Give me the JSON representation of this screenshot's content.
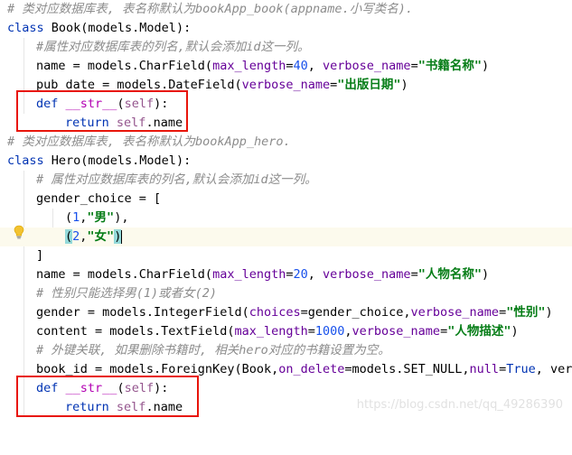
{
  "colors": {
    "comment": "#8c8c8c",
    "keyword": "#0033b3",
    "string": "#067d17",
    "number": "#1750eb",
    "param": "#660099",
    "self": "#94558d",
    "highlight_box": "#e8150b",
    "current_line": "#fcfaed"
  },
  "lines": {
    "l1": {
      "comment": "# 类对应数据库表, 表名称默认为bookApp_book(appname.小写类名)."
    },
    "l2": {
      "kw": "class",
      "rest": " Book(models.Model):"
    },
    "l3": {
      "comment": "#属性对应数据库表的列名,默认会添加id这一列。"
    },
    "l4": {
      "a": "name = models.CharField(",
      "p1": "max_length",
      "b": "=",
      "n1": "40",
      "c": ", ",
      "p2": "verbose_name",
      "d": "=",
      "s1": "\"书籍名称\"",
      "e": ")"
    },
    "l5": {
      "a": "pub_date = models.DateField(",
      "p1": "verbose_name",
      "b": "=",
      "s1": "\"出版日期\"",
      "c": ")"
    },
    "l6": {
      "kw": "def",
      "sp": " ",
      "fn": "__str__",
      "a": "(",
      "self": "self",
      "b": "):"
    },
    "l7": {
      "kw": "return",
      "sp": " ",
      "self": "self",
      "rest": ".name"
    },
    "l8": {
      "comment": "# 类对应数据库表, 表名称默认为bookApp_hero."
    },
    "l9": {
      "kw": "class",
      "rest": " Hero(models.Model):"
    },
    "l10": {
      "comment": "# 属性对应数据库表的列名,默认会添加id这一列。"
    },
    "l11": {
      "text": "gender_choice = ["
    },
    "l12": {
      "a": "(",
      "n1": "1",
      "b": ",",
      "s1": "\"男\"",
      "c": "),"
    },
    "l13": {
      "a": "(",
      "n1": "2",
      "b": ",",
      "s1": "\"女\"",
      "c": ")"
    },
    "l14": {
      "text": "]"
    },
    "l15": {
      "a": "name = models.CharField(",
      "p1": "max_length",
      "b": "=",
      "n1": "20",
      "c": ", ",
      "p2": "verbose_name",
      "d": "=",
      "s1": "\"人物名称\"",
      "e": ")"
    },
    "l16": {
      "comment": "# 性别只能选择男(1)或者女(2)"
    },
    "l17": {
      "a": "gender = models.IntegerField(",
      "p1": "choices",
      "b": "=gender_choice,",
      "p2": "verbose_name",
      "c": "=",
      "s1": "\"性别\"",
      "d": ")"
    },
    "l18": {
      "a": "content = models.TextField(",
      "p1": "max_length",
      "b": "=",
      "n1": "1000",
      "c": ",",
      "p2": "verbose_name",
      "d": "=",
      "s1": "\"人物描述\"",
      "e": ")"
    },
    "l19": {
      "comment": "# 外键关联, 如果删除书籍时, 相关hero对应的书籍设置为空。"
    },
    "l20": {
      "a": "book_id = models.ForeignKey(Book,",
      "p1": "on_delete",
      "b": "=models.SET_NULL,",
      "p2": "null",
      "c": "=",
      "kw": "True",
      "d": ", verb"
    },
    "l21": {
      "kw": "def",
      "sp": " ",
      "fn": "__str__",
      "a": "(",
      "self": "self",
      "b": "):"
    },
    "l22": {
      "kw": "return",
      "sp": " ",
      "self": "self",
      "rest": ".name"
    }
  },
  "icons": {
    "bulb": "lightbulb-icon"
  },
  "watermark": "https://blog.csdn.net/qq_49286390"
}
